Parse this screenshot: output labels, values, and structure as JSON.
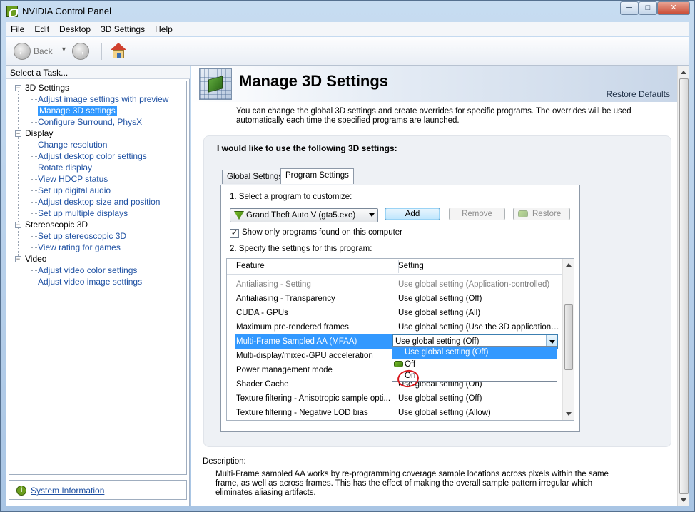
{
  "window": {
    "title": "NVIDIA Control Panel",
    "minimize": "─",
    "maximize": "□",
    "close": "✕"
  },
  "menu": [
    "File",
    "Edit",
    "Desktop",
    "3D Settings",
    "Help"
  ],
  "toolbar": {
    "back_label": "Back",
    "back_arrow": "←",
    "forward_arrow": "→",
    "dropdown": "▼"
  },
  "sidebar": {
    "header": "Select a Task...",
    "tree": [
      {
        "label": "3D Settings",
        "children": [
          "Adjust image settings with preview",
          "Manage 3D settings",
          "Configure Surround, PhysX"
        ]
      },
      {
        "label": "Display",
        "children": [
          "Change resolution",
          "Adjust desktop color settings",
          "Rotate display",
          "View HDCP status",
          "Set up digital audio",
          "Adjust desktop size and position",
          "Set up multiple displays"
        ]
      },
      {
        "label": "Stereoscopic 3D",
        "children": [
          "Set up stereoscopic 3D",
          "View rating for games"
        ]
      },
      {
        "label": "Video",
        "children": [
          "Adjust video color settings",
          "Adjust video image settings"
        ]
      }
    ],
    "expander_symbol": "−",
    "system_info": "System Information",
    "system_info_icon": "i"
  },
  "main": {
    "title": "Manage 3D Settings",
    "restore_defaults": "Restore Defaults",
    "intro": "You can change the global 3D settings and create overrides for specific programs. The overrides will be used automatically each time the specified programs are launched.",
    "panel_heading": "I would like to use the following 3D settings:",
    "tabs": [
      "Global Settings",
      "Program Settings"
    ],
    "step1": "1. Select a program to customize:",
    "program": "Grand Theft Auto V (gta5.exe)",
    "buttons": {
      "add": "Add",
      "remove": "Remove",
      "restore": "Restore"
    },
    "checkbox_label": "Show only programs found on this computer",
    "checkbox_mark": "✓",
    "step2": "2. Specify the settings for this program:",
    "grid": {
      "headers": [
        "Feature",
        "Setting"
      ],
      "rows": [
        {
          "feature": "Antialiasing - Setting",
          "setting": "Use global setting (Application-controlled)"
        },
        {
          "feature": "Antialiasing - Transparency",
          "setting": "Use global setting (Off)"
        },
        {
          "feature": "CUDA - GPUs",
          "setting": "Use global setting (All)"
        },
        {
          "feature": "Maximum pre-rendered frames",
          "setting": "Use global setting (Use the 3D application ..."
        },
        {
          "feature": "Multi-Frame Sampled AA (MFAA)",
          "setting": "Use global setting (Off)"
        },
        {
          "feature": "Multi-display/mixed-GPU acceleration",
          "setting": ""
        },
        {
          "feature": "Power management mode",
          "setting": ""
        },
        {
          "feature": "Shader Cache",
          "setting": "Use global setting (On)"
        },
        {
          "feature": "Texture filtering - Anisotropic sample opti...",
          "setting": "Use global setting (Off)"
        },
        {
          "feature": "Texture filtering - Negative LOD bias",
          "setting": "Use global setting (Allow)"
        }
      ]
    },
    "dropdown_options": [
      "Use global setting (Off)",
      "Off",
      "On"
    ],
    "description_label": "Description:",
    "description": "Multi-Frame sampled AA works by re-programming coverage sample locations across pixels within the same frame, as well as across frames. This has the effect of making the overall sample pattern irregular which eliminates aliasing artifacts."
  }
}
